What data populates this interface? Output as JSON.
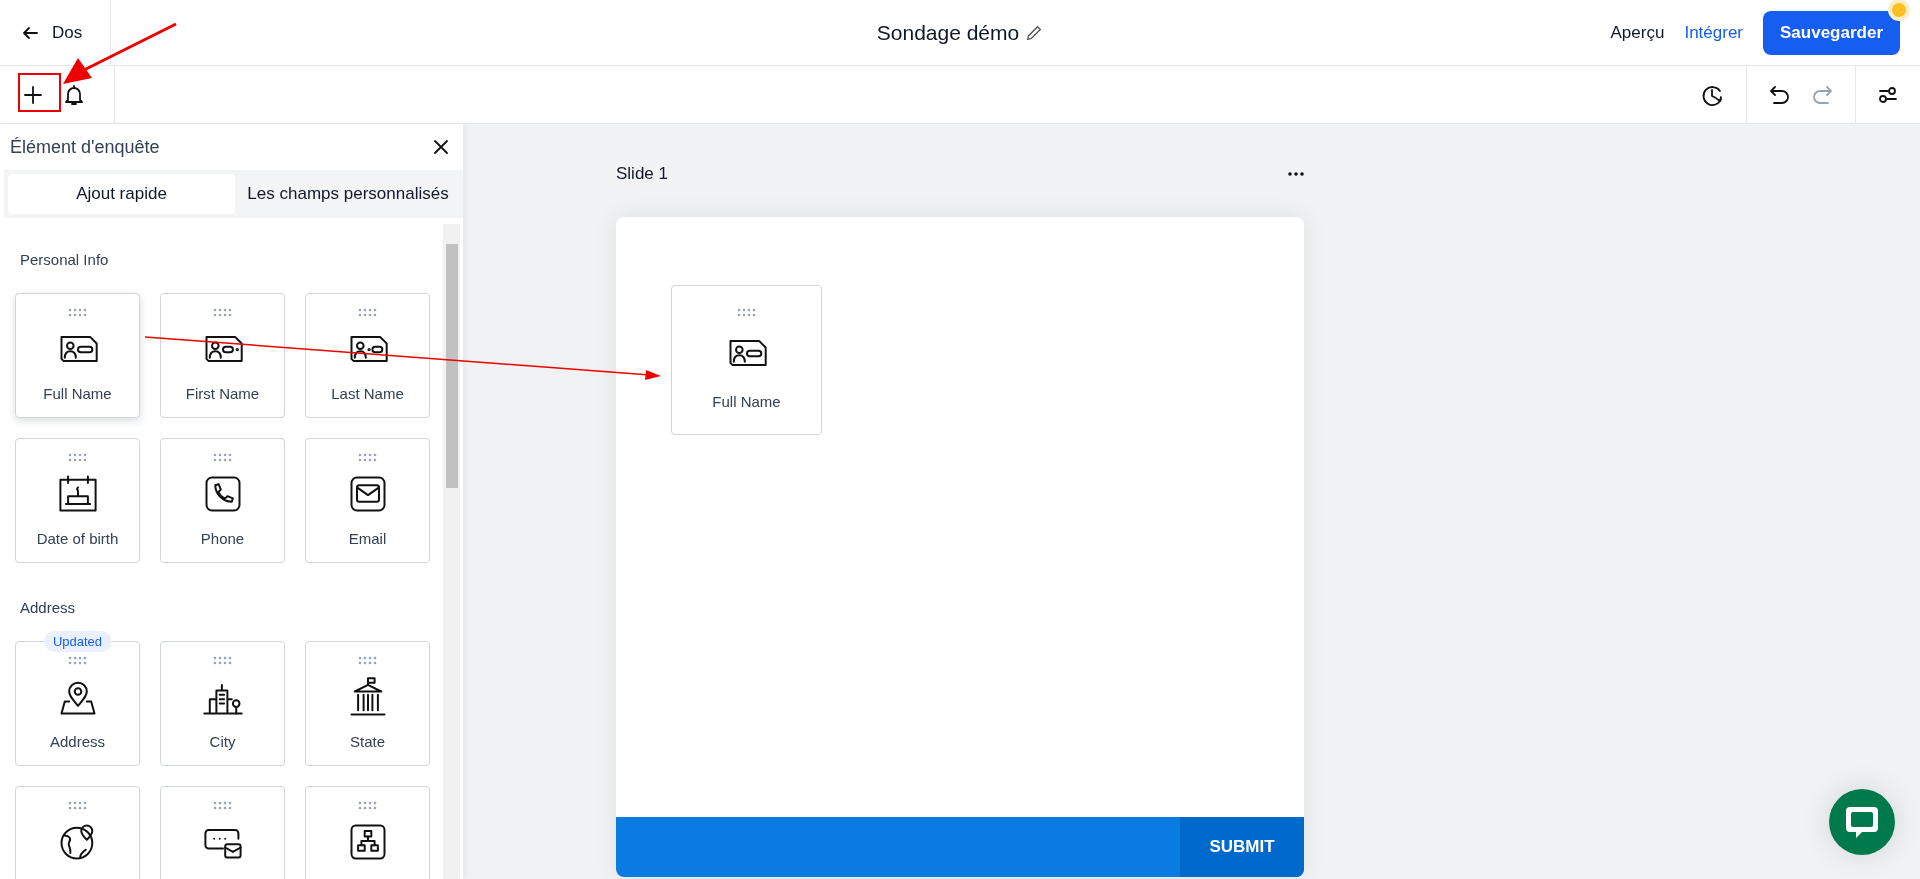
{
  "header": {
    "back_label": "Dos",
    "title": "Sondage démo",
    "links": [
      "Aperçu",
      "Intégrer"
    ],
    "save_button": "Sauvegarder"
  },
  "toolbar": {
    "undo": {
      "disabled": false
    },
    "redo": {
      "disabled": true
    }
  },
  "panel": {
    "title": "Élément d'enquête",
    "tabs": [
      {
        "label": "Ajout rapide",
        "selected": true
      },
      {
        "label": "Les champs personnalisés",
        "selected": false
      }
    ],
    "sections": [
      {
        "heading": "Personal Info",
        "items": [
          {
            "label": "Full Name",
            "kind": "full-name",
            "highlighted": true
          },
          {
            "label": "First Name",
            "kind": "first-name",
            "highlighted": false
          },
          {
            "label": "Last Name",
            "kind": "last-name",
            "highlighted": false
          },
          {
            "label": "Date of birth",
            "kind": "birthday",
            "highlighted": false
          },
          {
            "label": "Phone",
            "kind": "phone",
            "highlighted": false
          },
          {
            "label": "Email",
            "kind": "email",
            "highlighted": false
          }
        ]
      },
      {
        "heading": "Address",
        "items": [
          {
            "label": "Address",
            "kind": "address",
            "highlighted": false,
            "badge": "Updated"
          },
          {
            "label": "City",
            "kind": "city",
            "highlighted": false
          },
          {
            "label": "State",
            "kind": "state",
            "highlighted": false
          },
          {
            "kind": "country",
            "highlighted": false
          },
          {
            "kind": "postal",
            "highlighted": false
          },
          {
            "kind": "organization",
            "highlighted": false
          }
        ]
      }
    ]
  },
  "slide": {
    "title": "Slide 1",
    "fields": [
      {
        "label": "Full Name",
        "kind": "full-name"
      }
    ],
    "submit": "SUBMIT"
  }
}
